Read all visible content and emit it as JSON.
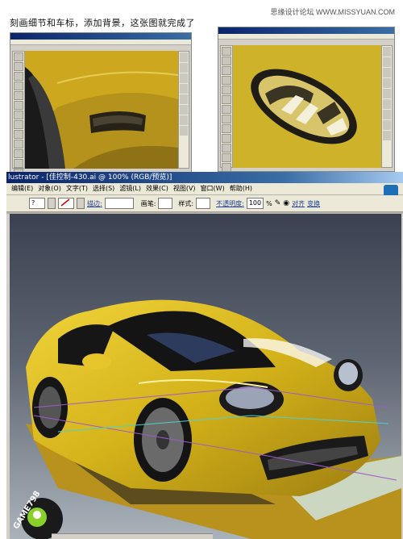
{
  "caption": "刻画细节和车标，添加背景，这张图就完成了",
  "watermark": "思缘设计论坛 WWW.MISSYUAN.COM",
  "window": {
    "title": "lustrator - [佳控制-430.ai @ 100% (RGB/预览)]"
  },
  "menu": {
    "items": [
      "编辑(E)",
      "对象(O)",
      "文字(T)",
      "选择(S)",
      "滤镜(L)",
      "效果(C)",
      "视图(V)",
      "窗口(W)",
      "帮助(H)"
    ]
  },
  "controlbar": {
    "stroke_label": "描边:",
    "brush_label": "画笔:",
    "style_label": "样式:",
    "opacity_label": "不透明度:",
    "opacity_value": "100",
    "opacity_unit": "%",
    "align_label": "对齐",
    "transform_label": "变换"
  },
  "badge": {
    "text": "GAME798"
  },
  "colors": {
    "car_yellow": "#d4b21a",
    "background": "#3b4150",
    "shadow_gold": "#b9921e",
    "floor": "#9aa3ab"
  }
}
